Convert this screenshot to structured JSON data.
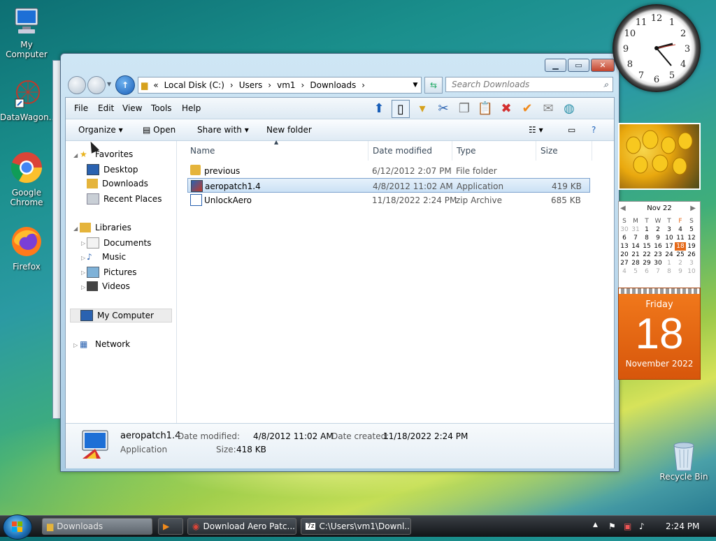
{
  "desktop": {
    "icons": [
      {
        "label": "My Computer"
      },
      {
        "label": "DataWagon..."
      },
      {
        "label": "Google Chrome"
      },
      {
        "label": "Firefox"
      }
    ],
    "recycle_bin": "Recycle Bin"
  },
  "window": {
    "address": {
      "crumbs": [
        "«",
        "Local Disk (C:)",
        "Users",
        "vm1",
        "Downloads"
      ]
    },
    "search": {
      "placeholder": "Search Downloads"
    },
    "menu": [
      "File",
      "Edit",
      "View",
      "Tools",
      "Help"
    ],
    "commands": {
      "organize": "Organize",
      "open": "Open",
      "share_with": "Share with",
      "new_folder": "New folder"
    },
    "nav": {
      "favorites": "Favorites",
      "favorites_items": [
        "Desktop",
        "Downloads",
        "Recent Places"
      ],
      "libraries": "Libraries",
      "libraries_items": [
        "Documents",
        "Music",
        "Pictures",
        "Videos"
      ],
      "computer": "My Computer",
      "network": "Network"
    },
    "columns": {
      "name": "Name",
      "date_modified": "Date modified",
      "type": "Type",
      "size": "Size"
    },
    "files": [
      {
        "name": "previous",
        "date": "6/12/2012 2:07 PM",
        "type": "File folder",
        "size": "",
        "selected": false
      },
      {
        "name": "aeropatch1.4",
        "date": "4/8/2012 11:02 AM",
        "type": "Application",
        "size": "419 KB",
        "selected": true
      },
      {
        "name": "UnlockAero",
        "date": "11/18/2022 2:24 PM",
        "type": "zip Archive",
        "size": "685 KB",
        "selected": false
      }
    ],
    "details": {
      "name": "aeropatch1.4",
      "kind": "Application",
      "date_modified_label": "Date modified:",
      "date_modified": "4/8/2012 11:02 AM",
      "date_created_label": "Date created:",
      "date_created": "11/18/2022 2:24 PM",
      "size_label": "Size:",
      "size": "418 KB"
    }
  },
  "gadgets": {
    "calendar_month": "Nov 22",
    "weekdays": [
      "S",
      "M",
      "T",
      "W",
      "T",
      "F",
      "S"
    ],
    "weeks": [
      [
        "30",
        "31",
        "1",
        "2",
        "3",
        "4",
        "5"
      ],
      [
        "6",
        "7",
        "8",
        "9",
        "10",
        "11",
        "12"
      ],
      [
        "13",
        "14",
        "15",
        "16",
        "17",
        "18",
        "19"
      ],
      [
        "20",
        "21",
        "22",
        "23",
        "24",
        "25",
        "26"
      ],
      [
        "27",
        "28",
        "29",
        "30",
        "1",
        "2",
        "3"
      ],
      [
        "4",
        "5",
        "6",
        "7",
        "8",
        "9",
        "10"
      ]
    ],
    "today_weekday": "Friday",
    "today_day": "18",
    "today_monthyear": "November 2022",
    "clock_numbers": [
      "12",
      "1",
      "2",
      "3",
      "4",
      "5",
      "6",
      "7",
      "8",
      "9",
      "10",
      "11"
    ]
  },
  "taskbar": {
    "tasks": [
      "Downloads",
      "",
      "Download Aero Patc...",
      "C:\\Users\\vm1\\Downl..."
    ],
    "time": "2:24 PM"
  }
}
